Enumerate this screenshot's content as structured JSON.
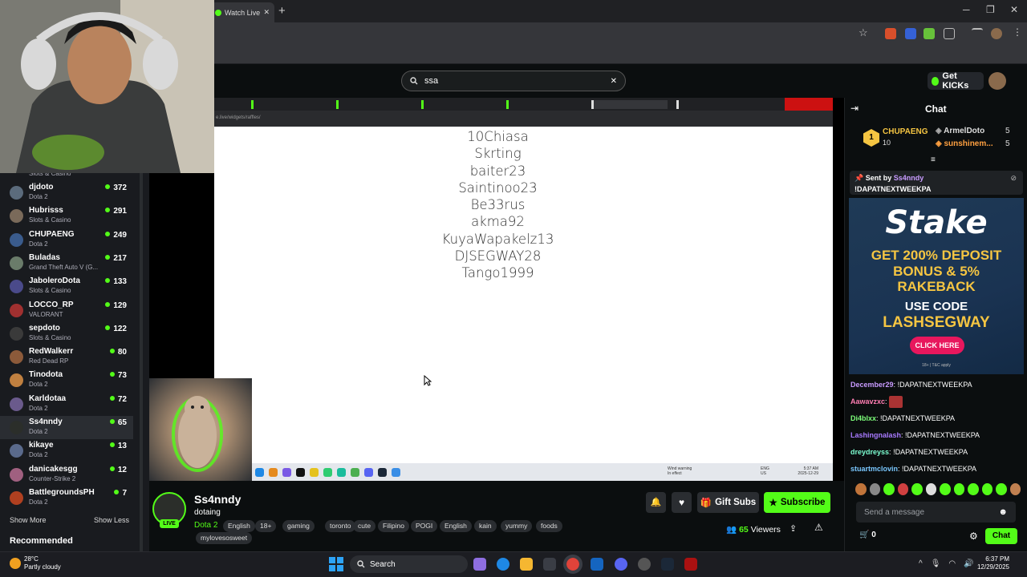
{
  "browser": {
    "tab_title": "Watch Live o",
    "tab_close": "✕",
    "new_tab": "+",
    "win_min": "─",
    "win_max": "❐",
    "win_close": "✕",
    "star": "☆"
  },
  "site": {
    "search_value": "ssa",
    "search_clear": "✕",
    "get_kicks": "Get KICKs"
  },
  "sidebar": {
    "partial_top": "Slots & Casino",
    "channels": [
      {
        "name": "djdoto",
        "game": "Dota 2",
        "viewers": "372",
        "color": "#5b6b7c"
      },
      {
        "name": "Hubrisss",
        "game": "Slots & Casino",
        "viewers": "291",
        "color": "#7a6a5a"
      },
      {
        "name": "CHUPAENG",
        "game": "Dota 2",
        "viewers": "249",
        "color": "#3a5b8c"
      },
      {
        "name": "Buladas",
        "game": "Grand Theft Auto V (G...",
        "viewers": "217",
        "color": "#6a7c6a"
      },
      {
        "name": "JaboleroDota",
        "game": "Slots & Casino",
        "viewers": "133",
        "color": "#4a4a8a"
      },
      {
        "name": "LOCCO_RP",
        "game": "VALORANT",
        "viewers": "129",
        "color": "#a03030"
      },
      {
        "name": "sepdoto",
        "game": "Slots & Casino",
        "viewers": "122",
        "color": "#3a3a3a"
      },
      {
        "name": "RedWalkerr",
        "game": "Red Dead RP",
        "viewers": "80",
        "color": "#8c5a3a"
      },
      {
        "name": "Tinodota",
        "game": "Dota 2",
        "viewers": "73",
        "color": "#c08040"
      },
      {
        "name": "Karldotaa",
        "game": "Dota 2",
        "viewers": "72",
        "color": "#6a5a8c"
      },
      {
        "name": "Ss4nndy",
        "game": "Dota 2",
        "viewers": "65",
        "color": "#2b2e2a"
      },
      {
        "name": "kikaye",
        "game": "Dota 2",
        "viewers": "13",
        "color": "#5a6a8c"
      },
      {
        "name": "danicakesgg",
        "game": "Counter-Strike 2",
        "viewers": "12",
        "color": "#a06080"
      },
      {
        "name": "BattlegroundsPH",
        "game": "Dota 2",
        "viewers": "7",
        "color": "#b04020"
      }
    ],
    "show_more": "Show More",
    "show_less": "Show Less",
    "recommended": "Recommended"
  },
  "stream": {
    "inner_url": "e.live/widgets/raffles/",
    "winners": [
      "10Chiasa",
      "Skrting",
      "baiter23",
      "Saintinoo23",
      "Be33rus",
      "akma92",
      "KuyaWapakelz13",
      "DJSEGWAY28",
      "Tango1999"
    ],
    "inner_clock_1": "5:37 AM",
    "inner_clock_2": "2025-12-29",
    "inner_weather": "Wind warning",
    "inner_weather_2": "In effect",
    "inner_lang_1": "ENG",
    "inner_lang_2": "US"
  },
  "channel": {
    "name": "Ss4nndy",
    "title": "dotaing",
    "game": "Dota 2",
    "live": "LIVE",
    "tags": [
      "English",
      "18+",
      "gaming",
      "toronto",
      "cute",
      "Filipino",
      "POGI",
      "English",
      "kain",
      "yummy",
      "foods",
      "mylovesosweet"
    ],
    "gift_subs": "Gift Subs",
    "subscribe": "Subscribe",
    "viewers_count": "65",
    "viewers_label": "Viewers"
  },
  "chat": {
    "title": "Chat",
    "gifters": [
      {
        "name": "CHUPAENG",
        "count": "10",
        "rank": "1"
      },
      {
        "name": "ArmelDoto",
        "count": "5"
      },
      {
        "name": "sunshinem...",
        "count": "5"
      }
    ],
    "pinned_by_label": "Sent by",
    "pinned_by": "Ss4nndy",
    "pinned_text": "!DAPATNEXTWEEKPA",
    "ad": {
      "brand": "Stake",
      "line1": "GET 200% DEPOSIT",
      "line2": "BONUS & 5%",
      "line3": "RAKEBACK",
      "line4": "USE CODE",
      "line5": "LASHSEGWAY",
      "cta": "CLICK HERE",
      "fine": "18+ | T&C apply",
      "colors": {
        "gold": "#f5c542",
        "pink": "#e8175d"
      }
    },
    "messages": [
      {
        "user": "December29",
        "text": "!DAPATNEXTWEEKPA",
        "color": "#c89bff"
      },
      {
        "user": "Aawavzxc",
        "text": "",
        "color": "#ff7eb3"
      },
      {
        "user": "Di4blxx",
        "text": "!DAPATNEXTWEEKPA",
        "color": "#7dff7a"
      },
      {
        "user": "Lashingnalash",
        "text": "!DAPATNEXTWEEKPA",
        "color": "#a87aff"
      },
      {
        "user": "dreydreyss",
        "text": "!DAPATNEXTWEEKPA",
        "color": "#7dffd2"
      },
      {
        "user": "stuartmclovin",
        "text": "!DAPATNEXTWEEKPA",
        "color": "#7ac8ff"
      }
    ],
    "input_placeholder": "Send a message",
    "cart_count": "0",
    "send": "Chat"
  },
  "taskbar": {
    "temp": "28°C",
    "weather": "Partly cloudy",
    "search": "Search",
    "time": "6:37 PM",
    "date": "12/29/2025"
  },
  "colors": {
    "accent": "#53fc18",
    "bg": "#0b0e0f",
    "panel": "#191b1f"
  }
}
